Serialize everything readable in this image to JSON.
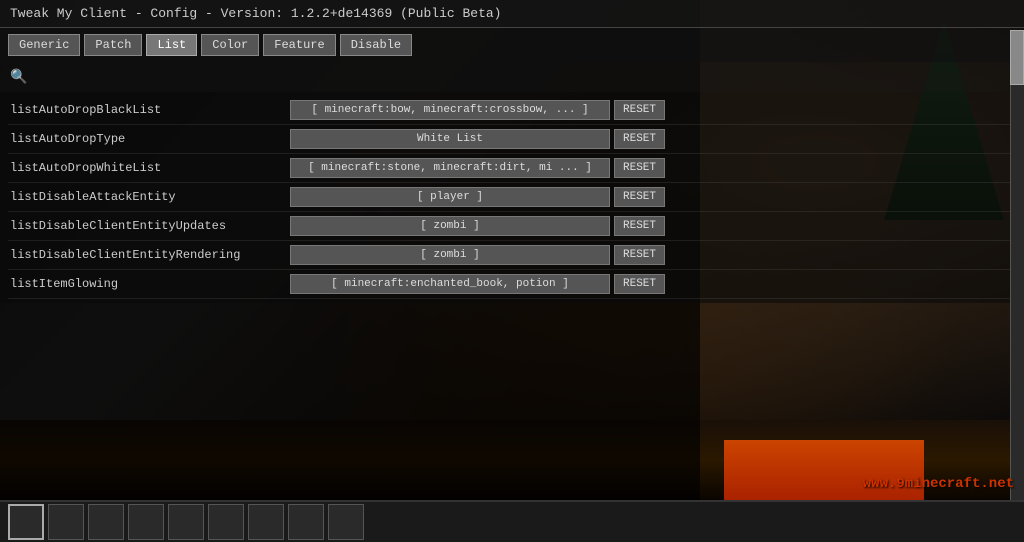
{
  "title": "Tweak My Client - Config - Version: 1.2.2+de14369 (Public Beta)",
  "tabs": [
    {
      "id": "generic",
      "label": "Generic",
      "active": false
    },
    {
      "id": "patch",
      "label": "Patch",
      "active": false
    },
    {
      "id": "list",
      "label": "List",
      "active": true
    },
    {
      "id": "color",
      "label": "Color",
      "active": false
    },
    {
      "id": "feature",
      "label": "Feature",
      "active": false
    },
    {
      "id": "disable",
      "label": "Disable",
      "active": false
    }
  ],
  "search": {
    "icon": "🔍"
  },
  "config_rows": [
    {
      "id": "listAutoDropBlackList",
      "label": "listAutoDropBlackList",
      "value": "[ minecraft:bow, minecraft:crossbow, ... ]",
      "reset_label": "RESET"
    },
    {
      "id": "listAutoDropType",
      "label": "listAutoDropType",
      "value": "White List",
      "reset_label": "RESET"
    },
    {
      "id": "listAutoDropWhiteList",
      "label": "listAutoDropWhiteList",
      "value": "[ minecraft:stone, minecraft:dirt, mi ... ]",
      "reset_label": "RESET"
    },
    {
      "id": "listDisableAttackEntity",
      "label": "listDisableAttackEntity",
      "value": "[ player ]",
      "reset_label": "RESET"
    },
    {
      "id": "listDisableClientEntityUpdates",
      "label": "listDisableClientEntityUpdates",
      "value": "[ zombi ]",
      "reset_label": "RESET"
    },
    {
      "id": "listDisableClientEntityRendering",
      "label": "listDisableClientEntityRendering",
      "value": "[ zombi ]",
      "reset_label": "RESET"
    },
    {
      "id": "listItemGlowing",
      "label": "listItemGlowing",
      "value": "[ minecraft:enchanted_book, potion ]",
      "reset_label": "RESET"
    }
  ],
  "watermark": "www.9minecraft.net",
  "colors": {
    "tab_active_bg": "#777777",
    "tab_bg": "#555555",
    "value_bg": "#555555",
    "reset_bg": "#555555",
    "accent_red": "#cc3300"
  }
}
